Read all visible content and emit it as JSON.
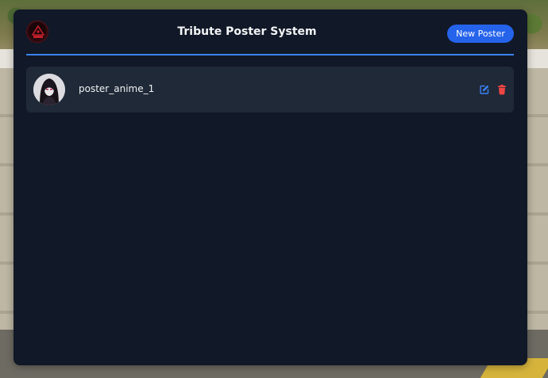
{
  "app": {
    "title": "Tribute Poster System",
    "logo_icon": "tribute-logo-icon",
    "new_button_label": "New Poster"
  },
  "posters": [
    {
      "name": "poster_anime_1",
      "thumbnail_icon": "anime-poster-thumbnail",
      "actions": {
        "edit_icon": "edit-icon",
        "delete_icon": "trash-icon"
      }
    }
  ],
  "colors": {
    "panel_bg": "#111827",
    "row_bg": "#1f2937",
    "accent": "#3b82f6",
    "button_bg": "#2563eb",
    "edit_icon": "#3b82f6",
    "delete_icon": "#ef4444",
    "text": "#f3f4f6"
  }
}
